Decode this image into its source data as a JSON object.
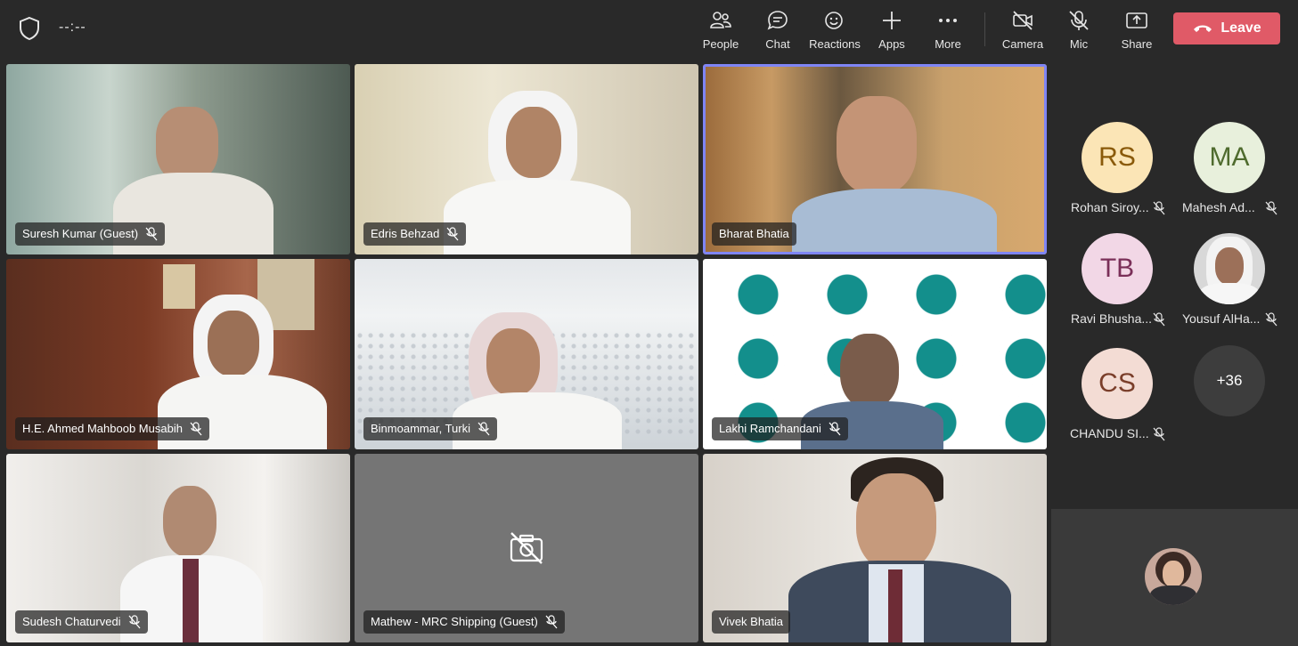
{
  "topbar": {
    "timer": "--:--",
    "buttons": [
      {
        "label": "People",
        "icon": "people-icon"
      },
      {
        "label": "Chat",
        "icon": "chat-icon"
      },
      {
        "label": "Reactions",
        "icon": "reactions-icon"
      },
      {
        "label": "Apps",
        "icon": "plus-icon"
      },
      {
        "label": "More",
        "icon": "more-icon"
      },
      {
        "label": "Camera",
        "icon": "camera-off-icon"
      },
      {
        "label": "Mic",
        "icon": "mic-off-icon"
      },
      {
        "label": "Share",
        "icon": "share-icon"
      }
    ],
    "leave_label": "Leave"
  },
  "tiles": [
    {
      "name": "Suresh Kumar (Guest)"
    },
    {
      "name": "Edris Behzad"
    },
    {
      "name": "Bharat Bhatia"
    },
    {
      "name": "H.E. Ahmed Mahboob Musabih"
    },
    {
      "name": "Binmoammar, Turki"
    },
    {
      "name": "Lakhi Ramchandani"
    },
    {
      "name": "Sudesh Chaturvedi"
    },
    {
      "name": "Mathew - MRC Shipping (Guest)"
    },
    {
      "name": "Vivek Bhatia"
    }
  ],
  "roster": [
    {
      "initials": "RS",
      "name": "Rohan Siroy...",
      "bg": "#fbe5b6",
      "fg": "#8a5a0a"
    },
    {
      "initials": "MA",
      "name": "Mahesh Ad...",
      "bg": "#e8f0dc",
      "fg": "#4f6b2e"
    },
    {
      "initials": "TB",
      "name": "Ravi Bhusha...",
      "bg": "#f2d7e6",
      "fg": "#7a2f58"
    },
    {
      "initials": "",
      "name": "Yousuf AlHa...",
      "bg": "#d8d8d8",
      "fg": "#333"
    },
    {
      "initials": "CS",
      "name": "CHANDU SI...",
      "bg": "#f3dcd4",
      "fg": "#7a3e2a"
    }
  ],
  "overflow_count": "+36",
  "colors": {
    "background": "#292929",
    "leave_button": "#e05a67",
    "active_speaker": "#7f85f5",
    "muted_tile": "#757575"
  }
}
